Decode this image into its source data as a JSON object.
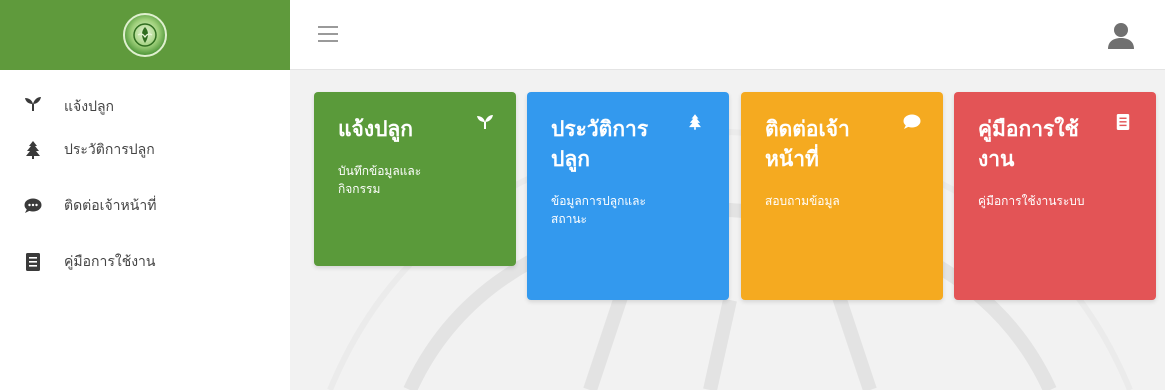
{
  "colors": {
    "brand": "#5f9a3c",
    "card_green": "#5a9a3a",
    "card_blue": "#3399ee",
    "card_orange": "#f5aa20",
    "card_red": "#e35456"
  },
  "sidebar": {
    "items": [
      {
        "label": "แจ้งปลูก",
        "icon": "sprout-icon"
      },
      {
        "label": "ประวัติการปลูก",
        "icon": "tree-icon"
      },
      {
        "label": "ติดต่อเจ้าหน้าที่",
        "icon": "chat-icon"
      },
      {
        "label": "คู่มือการใช้งาน",
        "icon": "book-icon"
      }
    ]
  },
  "cards": [
    {
      "title": "แจ้งปลูก",
      "subtitle": "บันทึกข้อมูลและกิจกรรม",
      "icon": "sprout-icon"
    },
    {
      "title": "ประวัติการปลูก",
      "subtitle": "ข้อมูลการปลูกและสถานะ",
      "icon": "tree-icon"
    },
    {
      "title": "ติดต่อเจ้าหน้าที่",
      "subtitle": "สอบถามข้อมูล",
      "icon": "chat-icon"
    },
    {
      "title": "คู่มือการใช้งาน",
      "subtitle": "คู่มือการใช้งานระบบ",
      "icon": "book-icon"
    }
  ]
}
